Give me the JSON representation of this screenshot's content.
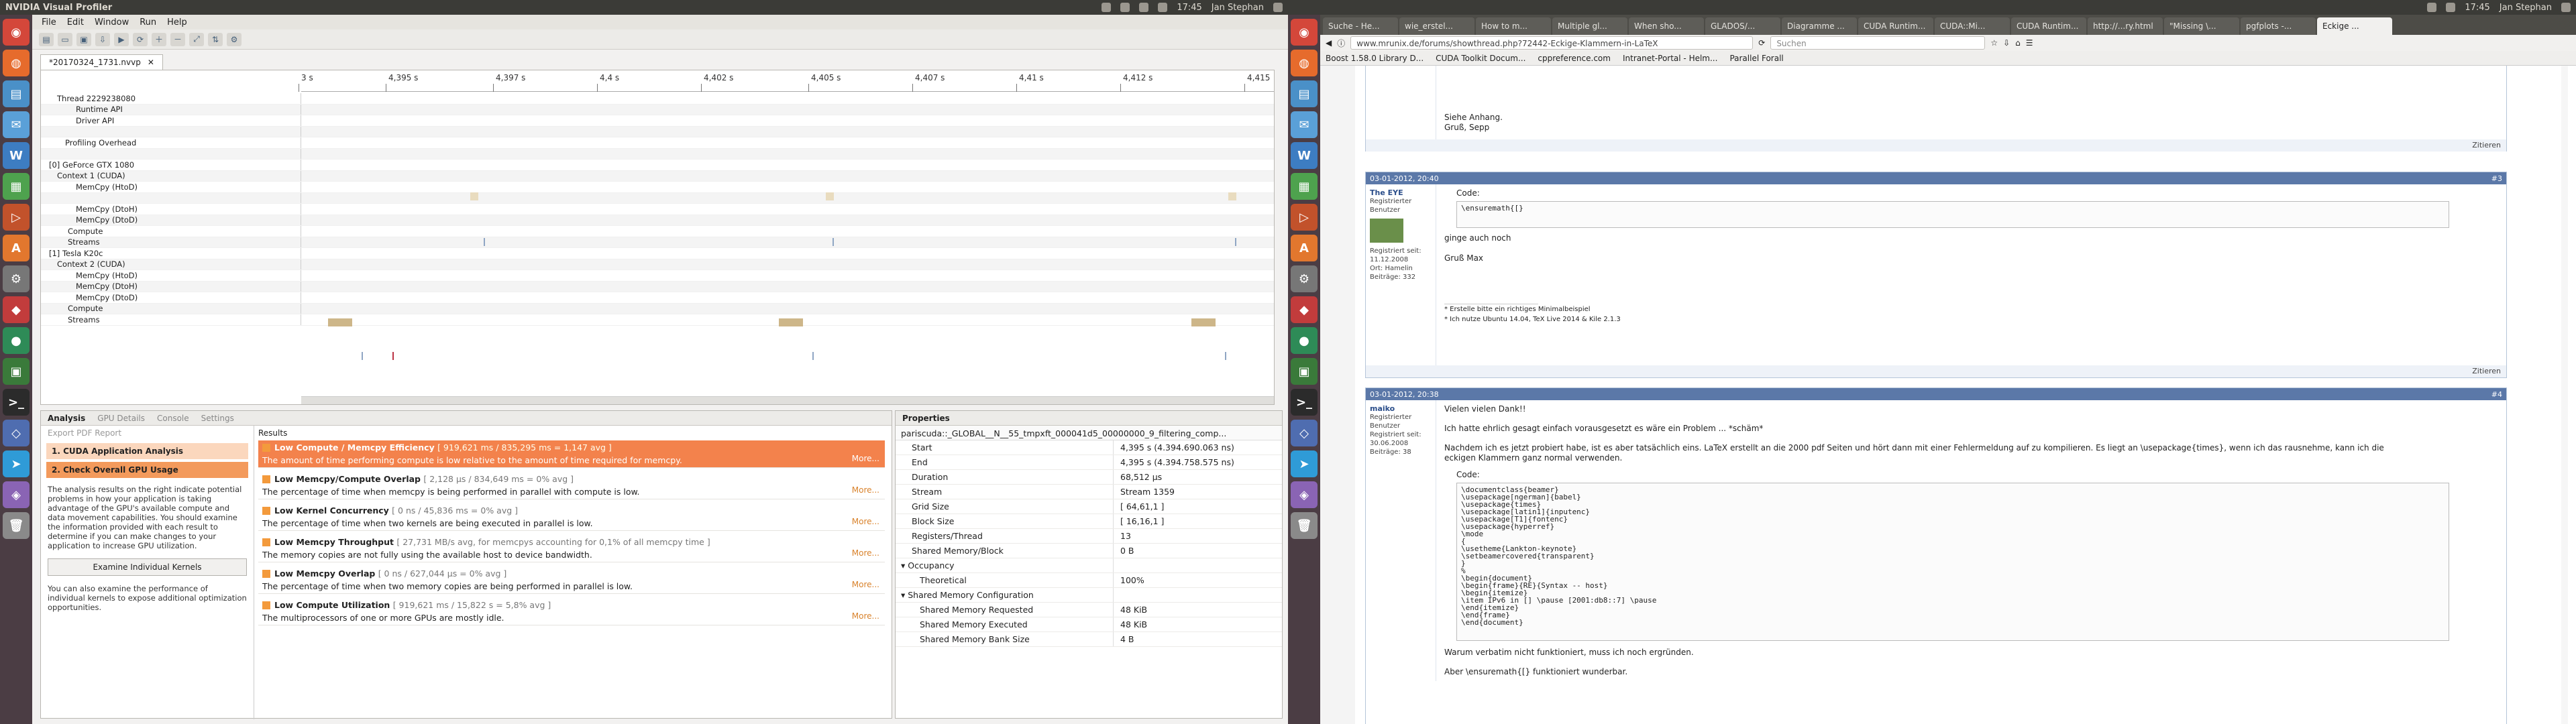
{
  "left": {
    "topbar": {
      "app": "NVIDIA Visual Profiler",
      "time": "17:45",
      "user": "Jan Stephan"
    },
    "menu": [
      "File",
      "Edit",
      "Window",
      "Run",
      "Help"
    ],
    "editor_tab": "*20170324_1731.nvvp",
    "timeline": {
      "ticks": [
        "3 s",
        "4,395 s",
        "4,397 s",
        "4,4 s",
        "4,402 s",
        "4,405 s",
        "4,407 s",
        "4,41 s",
        "4,412 s",
        "4,415"
      ],
      "rows": [
        "Thread 2229238080",
        "Runtime API",
        "Driver API",
        "",
        "Profiling Overhead",
        "",
        "[0] GeForce GTX 1080",
        "Context 1 (CUDA)",
        "MemCpy (HtoD)",
        "",
        "MemCpy (DtoH)",
        "MemCpy (DtoD)",
        "Compute",
        "Streams",
        "[1] Tesla K20c",
        "Context 2 (CUDA)",
        "MemCpy (HtoD)",
        "MemCpy (DtoH)",
        "MemCpy (DtoD)",
        "Compute",
        "Streams"
      ]
    },
    "analysis": {
      "tabs": [
        "Analysis",
        "GPU Details",
        "Console",
        "Settings"
      ],
      "export": "Export PDF Report",
      "step1": "1. CUDA Application Analysis",
      "step2": "2. Check Overall GPU Usage",
      "desc1": "The analysis results on the right indicate potential problems in how your application is taking advantage of the GPU's available compute and data movement capabilities. You should examine the information provided with each result to determine if you can make changes to your application to increase GPU utilization.",
      "examine": "Examine Individual Kernels",
      "desc2": "You can also examine the performance of individual kernels to expose additional optimization opportunities.",
      "results_label": "Results",
      "results": [
        {
          "title": "Low Compute / Memcpy Efficiency",
          "stat": "[ 919,621 ms / 835,295 ms = 1,147 avg ]",
          "desc": "The amount of time performing compute is low relative to the amount of time required for memcpy."
        },
        {
          "title": "Low Memcpy/Compute Overlap",
          "stat": "[ 2,128 µs / 834,649 ms = 0% avg ]",
          "desc": "The percentage of time when memcpy is being performed in parallel with compute is low."
        },
        {
          "title": "Low Kernel Concurrency",
          "stat": "[ 0 ns / 45,836 ms = 0% avg ]",
          "desc": "The percentage of time when two kernels are being executed in parallel is low."
        },
        {
          "title": "Low Memcpy Throughput",
          "stat": "[ 27,731 MB/s avg, for memcpys accounting for 0,1% of all memcpy time ]",
          "desc": "The memory copies are not fully using the available host to device bandwidth."
        },
        {
          "title": "Low Memcpy Overlap",
          "stat": "[ 0 ns / 627,044 µs = 0% avg ]",
          "desc": "The percentage of time when two memory copies are being performed in parallel is low."
        },
        {
          "title": "Low Compute Utilization",
          "stat": "[ 919,621 ms / 15,822 s = 5,8% avg ]",
          "desc": "The multiprocessors of one or more GPUs are mostly idle."
        }
      ],
      "more": "More..."
    },
    "properties": {
      "title": "Properties",
      "kernel": "pariscuda::_GLOBAL__N__55_tmpxft_000041d5_00000000_9_filtering_comp...",
      "rows": [
        {
          "k": "Start",
          "v": "4,395 s (4.394.690.063 ns)"
        },
        {
          "k": "End",
          "v": "4,395 s (4.394.758.575 ns)"
        },
        {
          "k": "Duration",
          "v": "68,512 µs"
        },
        {
          "k": "Stream",
          "v": "Stream 1359"
        },
        {
          "k": "Grid Size",
          "v": "[ 64,61,1 ]"
        },
        {
          "k": "Block Size",
          "v": "[ 16,16,1 ]"
        },
        {
          "k": "Registers/Thread",
          "v": "13"
        },
        {
          "k": "Shared Memory/Block",
          "v": "0 B"
        }
      ],
      "occupancy": "Occupancy",
      "theoretical": {
        "k": "Theoretical",
        "v": "100%"
      },
      "smc": "Shared Memory Configuration",
      "smc_rows": [
        {
          "k": "Shared Memory Requested",
          "v": "48 KiB"
        },
        {
          "k": "Shared Memory Executed",
          "v": "48 KiB"
        },
        {
          "k": "Shared Memory Bank Size",
          "v": "4 B"
        }
      ]
    }
  },
  "right": {
    "topbar": {
      "time": "17:45",
      "user": "Jan Stephan"
    },
    "tabs": [
      "Suche - He...",
      "wie_erstel...",
      "How to m...",
      "Multiple gl...",
      "When sho...",
      "GLADOS/...",
      "Diagramme ...",
      "CUDA Runtim...",
      "CUDA::Mi...",
      "CUDA Runtim...",
      "http://...ry.html",
      "\"Missing \\...",
      "pgfplots -...",
      "Eckige ..."
    ],
    "url": "www.mrunix.de/forums/showthread.php?72442-Eckige-Klammern-in-LaTeX",
    "search": "Suchen",
    "bookmarks": [
      "Boost 1.58.0 Library D...",
      "CUDA Toolkit Docum...",
      "cppreference.com",
      "Intranet-Portal - Helm...",
      "Parallel Forall"
    ],
    "post0": {
      "l1": "Siehe Anhang.",
      "l2": "Gruß, Sepp",
      "quote": "Zitieren"
    },
    "post1": {
      "date": "03-01-2012, 20:40",
      "num": "#3",
      "author": "The EYE",
      "rank": "Registrierter Benutzer",
      "reg": "Registriert seit: 11.12.2008",
      "ort": "Ort: Hamelin",
      "beitr": "Beiträge: 332",
      "code_label": "Code:",
      "code": "\\ensuremath{[}",
      "text": "ginge auch noch",
      "greet": "Gruß Max",
      "sig1": "* Erstelle bitte ein richtiges Minimalbeispiel",
      "sig2": "* Ich nutze Ubuntu 14.04, TeX Live 2014 & Kile 2.1.3",
      "quote": "Zitieren"
    },
    "post2": {
      "date": "03-01-2012, 20:38",
      "num": "#4",
      "author": "maiko",
      "rank": "Registrierter Benutzer",
      "reg": "Registriert seit: 30.06.2008",
      "beitr": "Beiträge: 38",
      "l1": "Vielen vielen Dank!!",
      "l2": "Ich hatte ehrlich gesagt einfach vorausgesetzt es wäre ein Problem ... *schäm*",
      "l3": "Nachdem ich es jetzt probiert habe, ist es aber tatsächlich eins. LaTeX erstellt an die 2000 pdf Seiten und hört dann mit einer Fehlermeldung auf zu kompilieren. Es liegt an \\usepackage{times}, wenn ich das rausnehme, kann ich die eckigen Klammern ganz normal verwenden.",
      "code_label": "Code:",
      "code": "\\documentclass{beamer}\n\\usepackage[ngerman]{babel}\n\\usepackage{times}\n\\usepackage[latin1]{inputenc}\n\\usepackage[T1]{fontenc}\n\\usepackage{hyperref}\n\\mode\n{\n\\usetheme{Lankton-keynote}\n\\setbeamercovered{transparent}\n}\n%\n\\begin{document}\n\\begin{frame}{RE}{Syntax -- host}\n\\begin{itemize}\n\\item IPv6 in [] \\pause [2001:db8::7] \\pause\n\\end{itemize}\n\\end{frame}\n\\end{document}",
      "l4": "Warum verbatim nicht funktioniert, muss ich noch ergründen.",
      "l5": "Aber \\ensuremath{[} funktioniert wunderbar."
    }
  }
}
